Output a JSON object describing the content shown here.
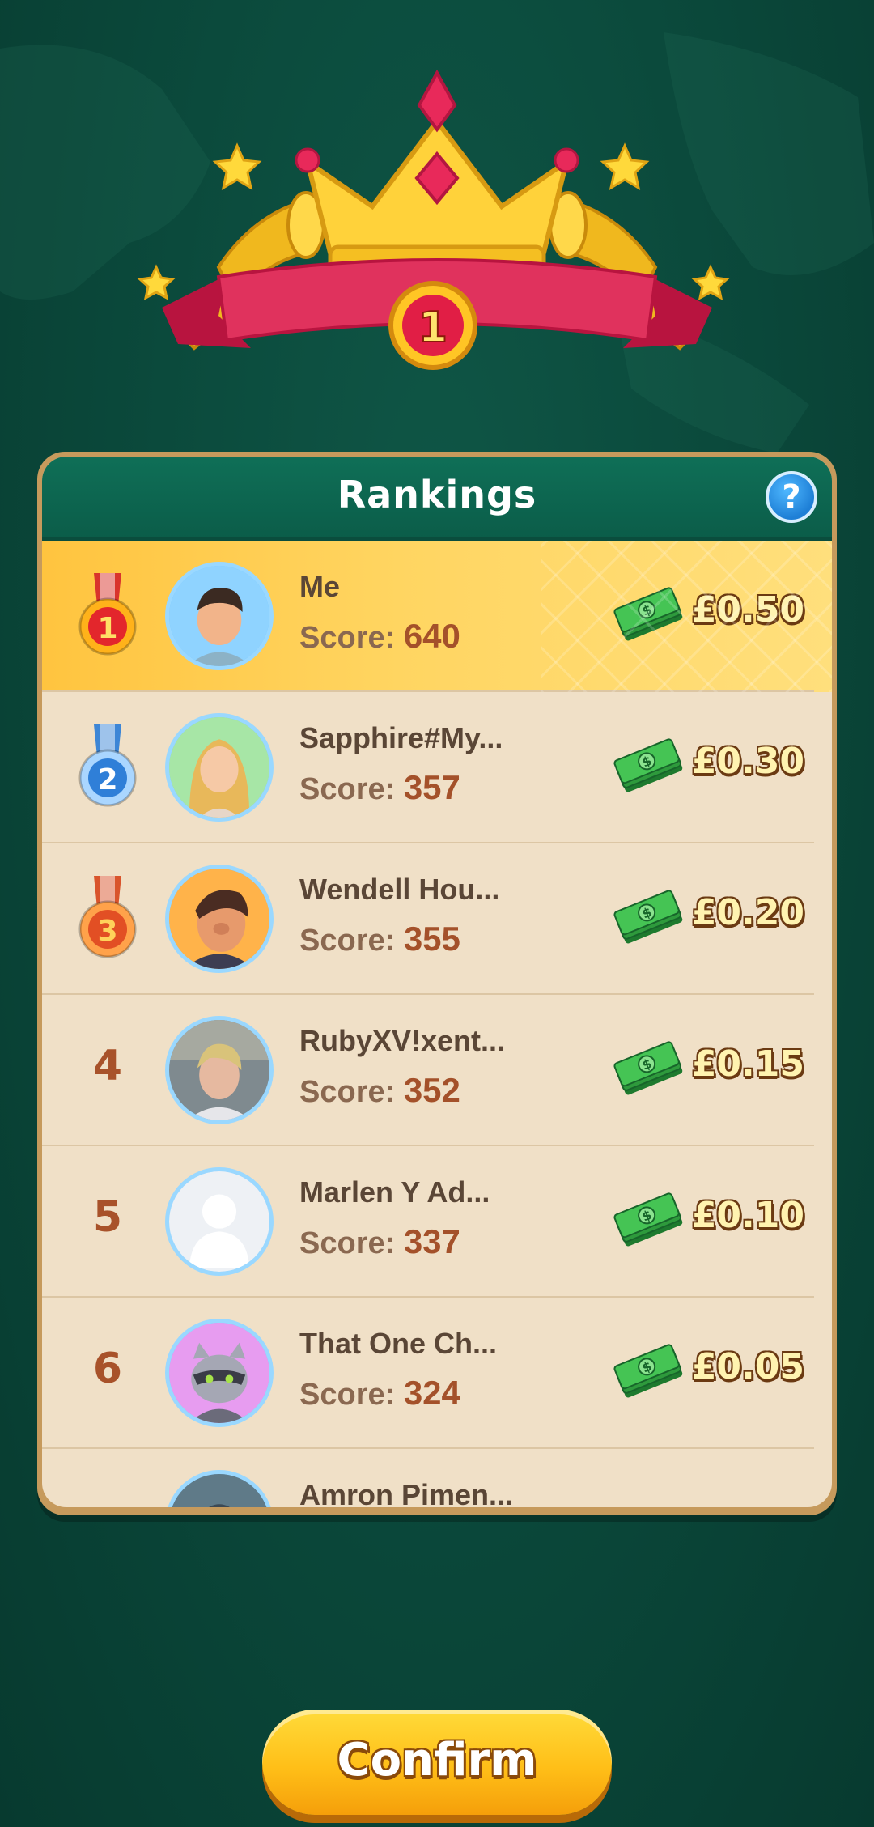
{
  "colors": {
    "background": "#0b4a3c",
    "header": "#0f6f57",
    "highlight_row": "#ffd561",
    "row_bg": "#f0e0c7",
    "accent_gold": "#ffbf18"
  },
  "emblem": {
    "rank_badge": "1"
  },
  "panel": {
    "title": "Rankings",
    "help_label": "?",
    "score_label": "Score: ",
    "rows": [
      {
        "rank": "1",
        "medal": "gold-medal",
        "name": "Me",
        "score": "640",
        "prize": "£0.50",
        "avatar": "man-avatar"
      },
      {
        "rank": "2",
        "medal": "silver-medal",
        "name": "Sapphire#My...",
        "score": "357",
        "prize": "£0.30",
        "avatar": "blonde-woman-avatar"
      },
      {
        "rank": "3",
        "medal": "bronze-medal",
        "name": "Wendell Hou...",
        "score": "355",
        "prize": "£0.20",
        "avatar": "cartoon-man-avatar"
      },
      {
        "rank": "4",
        "medal": "",
        "name": "RubyXV!xent...",
        "score": "352",
        "prize": "£0.15",
        "avatar": "photo-woman-avatar"
      },
      {
        "rank": "5",
        "medal": "",
        "name": "Marlen Y Ad...",
        "score": "337",
        "prize": "£0.10",
        "avatar": "default-silhouette-avatar"
      },
      {
        "rank": "6",
        "medal": "",
        "name": "That One Ch...",
        "score": "324",
        "prize": "£0.05",
        "avatar": "raccoon-avatar"
      },
      {
        "rank": "",
        "medal": "",
        "name": "Amron Pimen...",
        "score": "",
        "prize": "",
        "avatar": "partial-avatar"
      }
    ]
  },
  "confirm_button": {
    "label": "Confirm"
  }
}
